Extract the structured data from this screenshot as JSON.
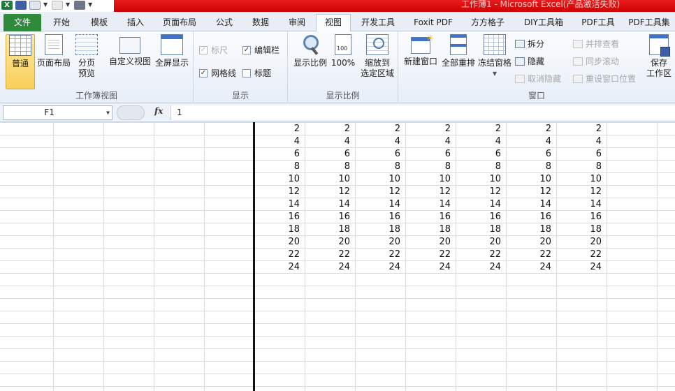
{
  "window": {
    "title": "工作薄1 - Microsoft Excel(产品激活失败)"
  },
  "quick_access": {
    "icons": [
      "excel-icon",
      "save-icon",
      "undo-icon",
      "redo-icon",
      "print-icon"
    ]
  },
  "tabs": [
    {
      "label": "文件",
      "active": false
    },
    {
      "label": "开始",
      "active": false
    },
    {
      "label": "模板",
      "active": false
    },
    {
      "label": "插入",
      "active": false
    },
    {
      "label": "页面布局",
      "active": false
    },
    {
      "label": "公式",
      "active": false
    },
    {
      "label": "数据",
      "active": false
    },
    {
      "label": "审阅",
      "active": false
    },
    {
      "label": "视图",
      "active": true
    },
    {
      "label": "开发工具",
      "active": false
    },
    {
      "label": "Foxit PDF",
      "active": false
    },
    {
      "label": "方方格子",
      "active": false
    },
    {
      "label": "DIY工具箱",
      "active": false
    },
    {
      "label": "PDF工具",
      "active": false
    },
    {
      "label": "PDF工具集",
      "active": false
    }
  ],
  "ribbon": {
    "workbook_views": {
      "label": "工作簿视图",
      "normal": "普通",
      "page_layout": "页面布局",
      "page_break_1": "分页",
      "page_break_2": "预览",
      "custom_views": "自定义视图",
      "full_screen": "全屏显示"
    },
    "show": {
      "label": "显示",
      "ruler": "标尺",
      "formula_bar": "编辑栏",
      "gridlines": "网格线",
      "headings": "标题",
      "ruler_checked": true,
      "formula_bar_checked": true,
      "gridlines_checked": true,
      "headings_checked": false
    },
    "zoom": {
      "label": "显示比例",
      "zoom": "显示比例",
      "hundred": "100%",
      "zoom_sel_1": "缩放到",
      "zoom_sel_2": "选定区域"
    },
    "window": {
      "label": "窗口",
      "new_window": "新建窗口",
      "arrange_all": "全部重排",
      "freeze_panes": "冻结窗格",
      "split": "拆分",
      "hide": "隐藏",
      "unhide": "取消隐藏",
      "side_by_side": "并排查看",
      "sync_scroll": "同步滚动",
      "reset_position": "重设窗口位置",
      "save_ws_1": "保存",
      "save_ws_2": "工作区"
    }
  },
  "formula_bar": {
    "name_box": "F1",
    "fx": "fx",
    "content": "1"
  },
  "sheet": {
    "columns_with_data": 7,
    "rows": [
      [
        "2",
        "2",
        "2",
        "2",
        "2",
        "2",
        "2"
      ],
      [
        "4",
        "4",
        "4",
        "4",
        "4",
        "4",
        "4"
      ],
      [
        "6",
        "6",
        "6",
        "6",
        "6",
        "6",
        "6"
      ],
      [
        "8",
        "8",
        "8",
        "8",
        "8",
        "8",
        "8"
      ],
      [
        "10",
        "10",
        "10",
        "10",
        "10",
        "10",
        "10"
      ],
      [
        "12",
        "12",
        "12",
        "12",
        "12",
        "12",
        "12"
      ],
      [
        "14",
        "14",
        "14",
        "14",
        "14",
        "14",
        "14"
      ],
      [
        "16",
        "16",
        "16",
        "16",
        "16",
        "16",
        "16"
      ],
      [
        "18",
        "18",
        "18",
        "18",
        "18",
        "18",
        "18"
      ],
      [
        "20",
        "20",
        "20",
        "20",
        "20",
        "20",
        "20"
      ],
      [
        "22",
        "22",
        "22",
        "22",
        "22",
        "22",
        "22"
      ],
      [
        "24",
        "24",
        "24",
        "24",
        "24",
        "24",
        "24"
      ]
    ]
  }
}
